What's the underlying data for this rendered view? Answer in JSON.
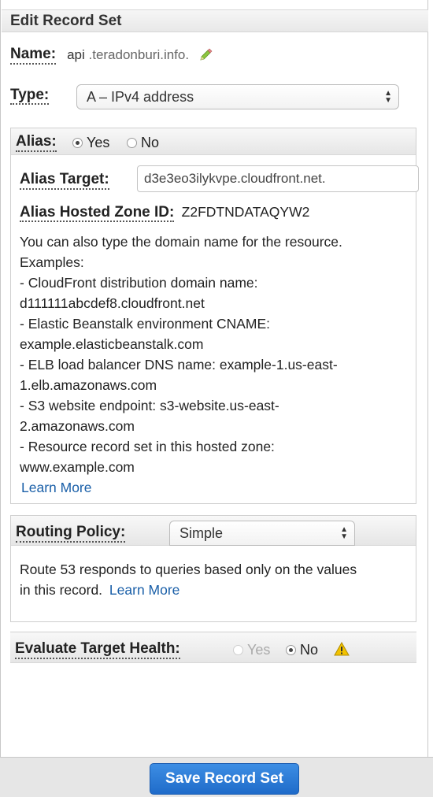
{
  "panel": {
    "title": "Edit Record Set"
  },
  "name": {
    "label": "Name:",
    "value_prefix": "api",
    "value_domain": ".teradonburi.info.",
    "edit_icon": "pencil-icon"
  },
  "type": {
    "label": "Type:",
    "selected": "A – IPv4 address"
  },
  "alias": {
    "label": "Alias:",
    "options": [
      "Yes",
      "No"
    ],
    "selected": "Yes",
    "target_label": "Alias Target:",
    "target_value": "d3e3eo3ilykvpe.cloudfront.net.",
    "zone_label": "Alias Hosted Zone ID:",
    "zone_value": "Z2FDTNDATAQYW2",
    "help_lines": [
      "You can also type the domain name for the resource.",
      "Examples:",
      "-  CloudFront distribution domain name:",
      "d111111abcdef8.cloudfront.net",
      "-  Elastic Beanstalk environment CNAME:",
      "example.elasticbeanstalk.com",
      "-  ELB load balancer DNS name: example-1.us-east-",
      "1.elb.amazonaws.com",
      "-  S3 website endpoint: s3-website.us-east-",
      "2.amazonaws.com",
      "-  Resource record set in this hosted zone:",
      "www.example.com"
    ],
    "learn_more": "Learn More"
  },
  "routing": {
    "label": "Routing Policy:",
    "selected": "Simple",
    "help_line1": "Route 53 responds to queries based only on the values",
    "help_line2": "in this record.",
    "learn_more": "Learn More"
  },
  "health": {
    "label": "Evaluate Target Health:",
    "options": [
      "Yes",
      "No"
    ],
    "selected": "No",
    "warning_icon": "warning-icon"
  },
  "footer": {
    "save_label": "Save Record Set"
  },
  "colors": {
    "link": "#1a5fa8",
    "button": "#2a7ad6",
    "warning": "#f2c200"
  }
}
